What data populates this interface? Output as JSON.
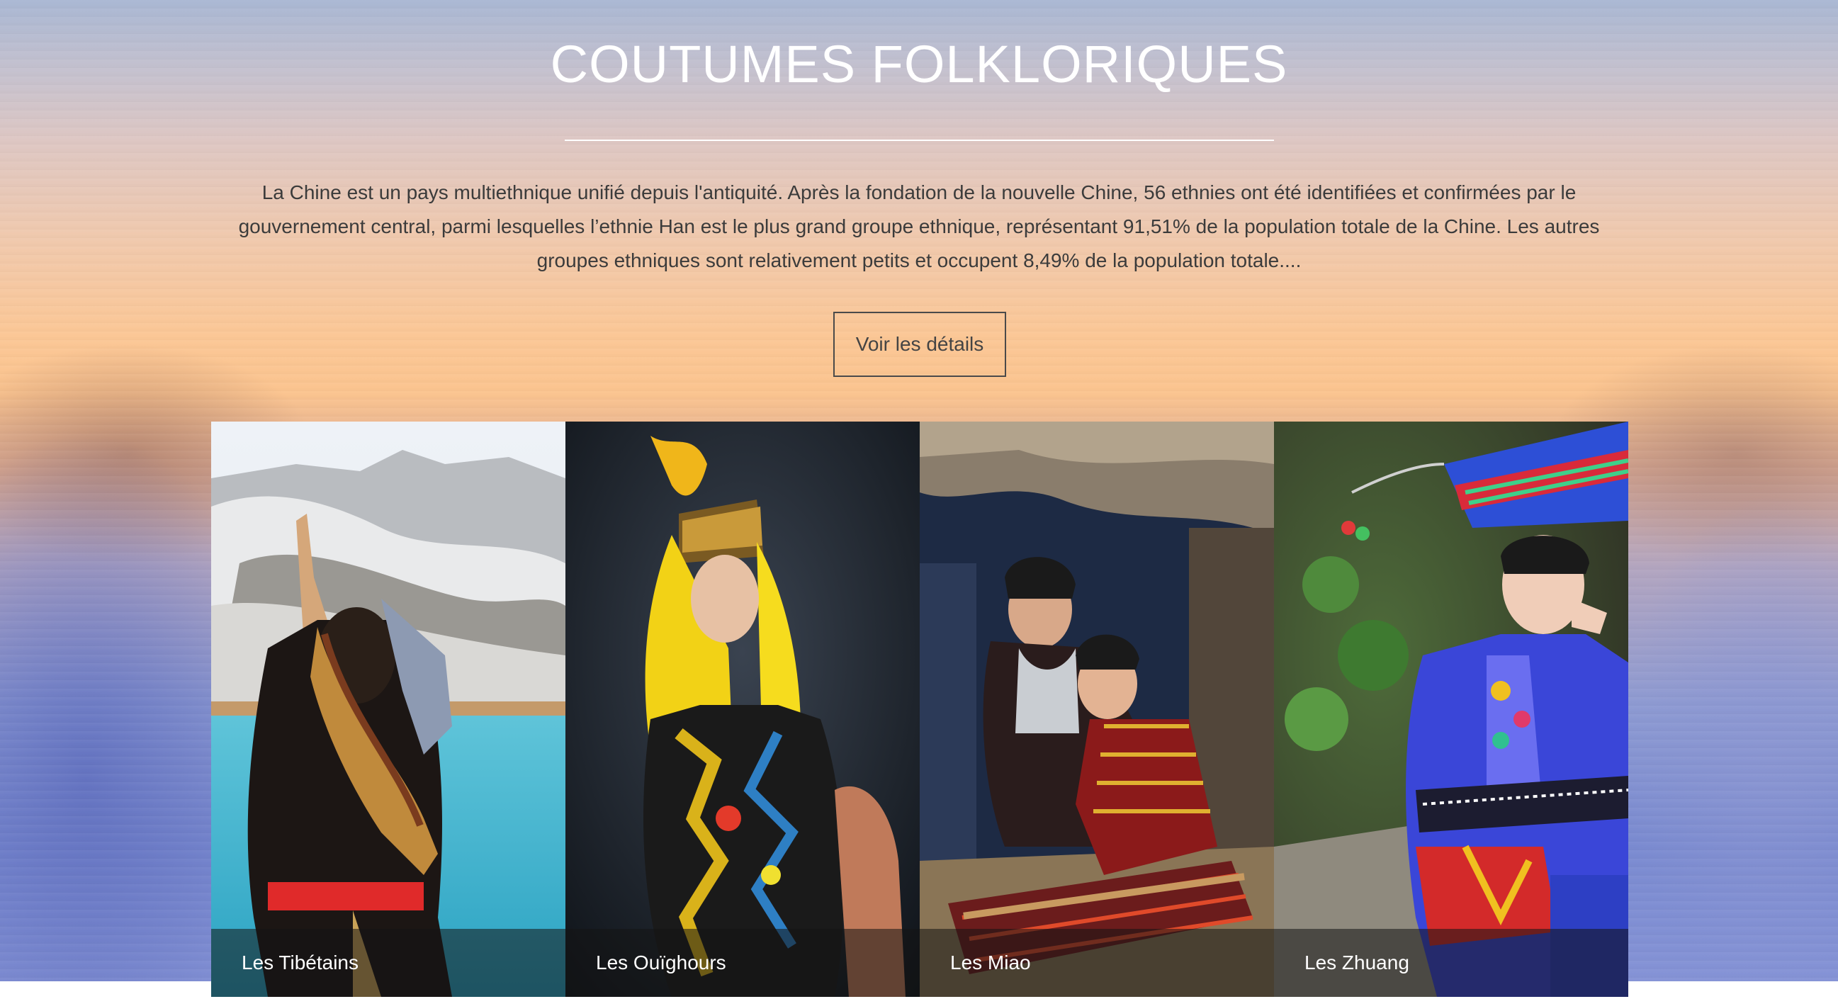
{
  "section": {
    "title": "COUTUMES FOLKLORIQUES",
    "intro": "La Chine est un pays multiethnique unifié depuis l'antiquité. Après la fondation de la nouvelle Chine, 56 ethnies ont été identifiées et confirmées par le gouvernement central, parmi lesquelles l’ethnie Han est le plus grand groupe ethnique, représentant 91,51% de la population totale de la Chine. Les autres groupes ethniques sont relativement petits et occupent 8,49% de la population totale....",
    "details_button": "Voir les détails"
  },
  "gallery": {
    "items": [
      {
        "caption": "Les Tibétains"
      },
      {
        "caption": "Les Ouïghours"
      },
      {
        "caption": "Les Miao"
      },
      {
        "caption": "Les Zhuang"
      }
    ]
  },
  "colors": {
    "title": "#ffffff",
    "body_text": "#3b3b3b",
    "caption_overlay": "rgba(20,20,20,0.55)"
  }
}
